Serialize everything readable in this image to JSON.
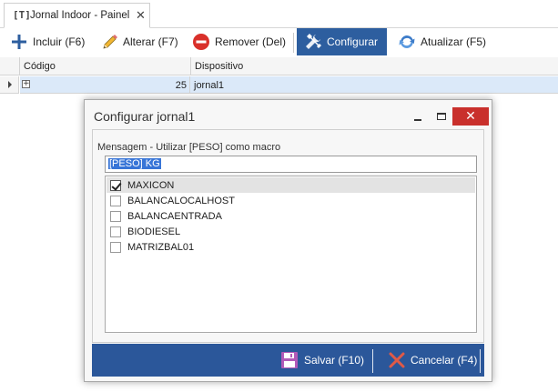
{
  "tab": {
    "title": "Jornal Indoor - Painel",
    "icon": "text-tool-icon",
    "close": "✕"
  },
  "toolbar": {
    "incluir": "Incluir (F6)",
    "alterar": "Alterar (F7)",
    "remover": "Remover (Del)",
    "configurar": "Configurar",
    "atualizar": "Atualizar (F5)"
  },
  "grid": {
    "columns": [
      "Código",
      "Dispositivo"
    ],
    "rows": [
      {
        "codigo": "25",
        "dispositivo": "jornal1"
      }
    ]
  },
  "dialog": {
    "title": "Configurar jornal1",
    "macro_label": "Mensagem - Utilizar [PESO] como macro",
    "macro_value": "[PESO] KG",
    "items": [
      {
        "label": "MAXICON",
        "checked": true
      },
      {
        "label": "BALANCALOCALHOST",
        "checked": false
      },
      {
        "label": "BALANCAENTRADA",
        "checked": false
      },
      {
        "label": "BIODIESEL",
        "checked": false
      },
      {
        "label": "MATRIZBAL01",
        "checked": false
      }
    ],
    "save": "Salvar (F10)",
    "cancel": "Cancelar (F4)"
  },
  "colors": {
    "accent": "#2b579a",
    "close": "#c9302c",
    "row_selected": "#dbe9f9"
  }
}
